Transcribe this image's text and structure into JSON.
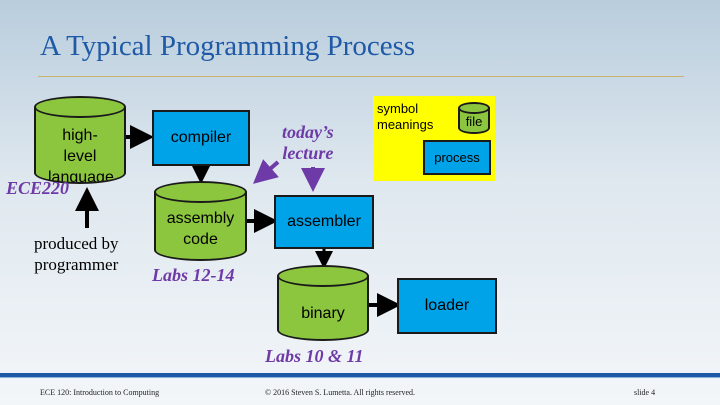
{
  "title": "A Typical Programming Process",
  "nodes": {
    "high_level": "high-level language",
    "compiler": "compiler",
    "assembly": "assembly code",
    "assembler": "assembler",
    "binary": "binary",
    "loader": "loader"
  },
  "annotations": {
    "ece220": "ECE220",
    "produced_by": "produced by\nprogrammer",
    "todays_lecture": "today’s\nlecture",
    "labs_12_14": "Labs 12-14",
    "labs_10_11": "Labs 10 & 11"
  },
  "legend": {
    "heading": "symbol\nmeanings",
    "file": "file",
    "process": "process"
  },
  "footer": {
    "course": "ECE 120: Introduction to Computing",
    "copyright": "© 2016 Steven S. Lumetta.  All rights reserved.",
    "slide": "slide 4"
  },
  "colors": {
    "file": "#8cc63f",
    "process": "#00a2e8",
    "legend_bg": "#ffff00",
    "annotation": "#6e3aa7",
    "title": "#1f5aa6"
  }
}
